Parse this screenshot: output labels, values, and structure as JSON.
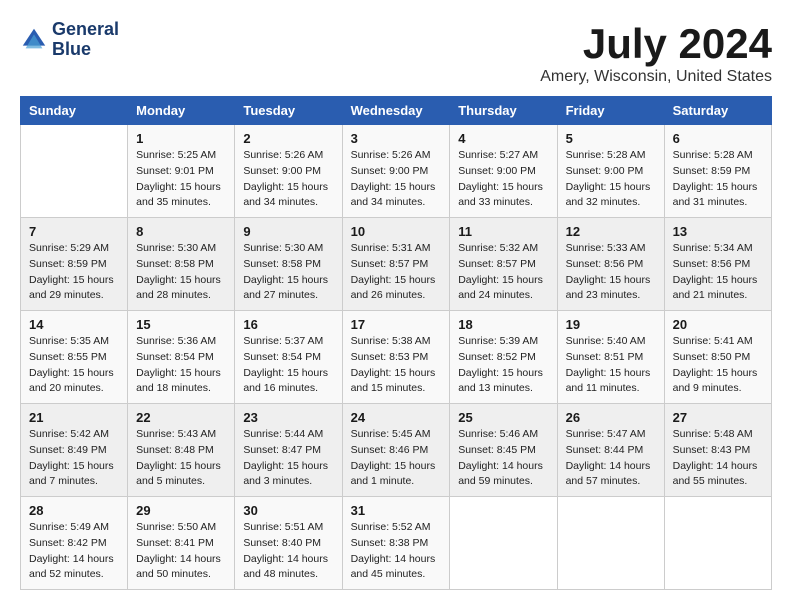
{
  "header": {
    "logo_line1": "General",
    "logo_line2": "Blue",
    "month": "July 2024",
    "location": "Amery, Wisconsin, United States"
  },
  "days_of_week": [
    "Sunday",
    "Monday",
    "Tuesday",
    "Wednesday",
    "Thursday",
    "Friday",
    "Saturday"
  ],
  "weeks": [
    [
      {
        "day": "",
        "info": ""
      },
      {
        "day": "1",
        "info": "Sunrise: 5:25 AM\nSunset: 9:01 PM\nDaylight: 15 hours\nand 35 minutes."
      },
      {
        "day": "2",
        "info": "Sunrise: 5:26 AM\nSunset: 9:00 PM\nDaylight: 15 hours\nand 34 minutes."
      },
      {
        "day": "3",
        "info": "Sunrise: 5:26 AM\nSunset: 9:00 PM\nDaylight: 15 hours\nand 34 minutes."
      },
      {
        "day": "4",
        "info": "Sunrise: 5:27 AM\nSunset: 9:00 PM\nDaylight: 15 hours\nand 33 minutes."
      },
      {
        "day": "5",
        "info": "Sunrise: 5:28 AM\nSunset: 9:00 PM\nDaylight: 15 hours\nand 32 minutes."
      },
      {
        "day": "6",
        "info": "Sunrise: 5:28 AM\nSunset: 8:59 PM\nDaylight: 15 hours\nand 31 minutes."
      }
    ],
    [
      {
        "day": "7",
        "info": "Sunrise: 5:29 AM\nSunset: 8:59 PM\nDaylight: 15 hours\nand 29 minutes."
      },
      {
        "day": "8",
        "info": "Sunrise: 5:30 AM\nSunset: 8:58 PM\nDaylight: 15 hours\nand 28 minutes."
      },
      {
        "day": "9",
        "info": "Sunrise: 5:30 AM\nSunset: 8:58 PM\nDaylight: 15 hours\nand 27 minutes."
      },
      {
        "day": "10",
        "info": "Sunrise: 5:31 AM\nSunset: 8:57 PM\nDaylight: 15 hours\nand 26 minutes."
      },
      {
        "day": "11",
        "info": "Sunrise: 5:32 AM\nSunset: 8:57 PM\nDaylight: 15 hours\nand 24 minutes."
      },
      {
        "day": "12",
        "info": "Sunrise: 5:33 AM\nSunset: 8:56 PM\nDaylight: 15 hours\nand 23 minutes."
      },
      {
        "day": "13",
        "info": "Sunrise: 5:34 AM\nSunset: 8:56 PM\nDaylight: 15 hours\nand 21 minutes."
      }
    ],
    [
      {
        "day": "14",
        "info": "Sunrise: 5:35 AM\nSunset: 8:55 PM\nDaylight: 15 hours\nand 20 minutes."
      },
      {
        "day": "15",
        "info": "Sunrise: 5:36 AM\nSunset: 8:54 PM\nDaylight: 15 hours\nand 18 minutes."
      },
      {
        "day": "16",
        "info": "Sunrise: 5:37 AM\nSunset: 8:54 PM\nDaylight: 15 hours\nand 16 minutes."
      },
      {
        "day": "17",
        "info": "Sunrise: 5:38 AM\nSunset: 8:53 PM\nDaylight: 15 hours\nand 15 minutes."
      },
      {
        "day": "18",
        "info": "Sunrise: 5:39 AM\nSunset: 8:52 PM\nDaylight: 15 hours\nand 13 minutes."
      },
      {
        "day": "19",
        "info": "Sunrise: 5:40 AM\nSunset: 8:51 PM\nDaylight: 15 hours\nand 11 minutes."
      },
      {
        "day": "20",
        "info": "Sunrise: 5:41 AM\nSunset: 8:50 PM\nDaylight: 15 hours\nand 9 minutes."
      }
    ],
    [
      {
        "day": "21",
        "info": "Sunrise: 5:42 AM\nSunset: 8:49 PM\nDaylight: 15 hours\nand 7 minutes."
      },
      {
        "day": "22",
        "info": "Sunrise: 5:43 AM\nSunset: 8:48 PM\nDaylight: 15 hours\nand 5 minutes."
      },
      {
        "day": "23",
        "info": "Sunrise: 5:44 AM\nSunset: 8:47 PM\nDaylight: 15 hours\nand 3 minutes."
      },
      {
        "day": "24",
        "info": "Sunrise: 5:45 AM\nSunset: 8:46 PM\nDaylight: 15 hours\nand 1 minute."
      },
      {
        "day": "25",
        "info": "Sunrise: 5:46 AM\nSunset: 8:45 PM\nDaylight: 14 hours\nand 59 minutes."
      },
      {
        "day": "26",
        "info": "Sunrise: 5:47 AM\nSunset: 8:44 PM\nDaylight: 14 hours\nand 57 minutes."
      },
      {
        "day": "27",
        "info": "Sunrise: 5:48 AM\nSunset: 8:43 PM\nDaylight: 14 hours\nand 55 minutes."
      }
    ],
    [
      {
        "day": "28",
        "info": "Sunrise: 5:49 AM\nSunset: 8:42 PM\nDaylight: 14 hours\nand 52 minutes."
      },
      {
        "day": "29",
        "info": "Sunrise: 5:50 AM\nSunset: 8:41 PM\nDaylight: 14 hours\nand 50 minutes."
      },
      {
        "day": "30",
        "info": "Sunrise: 5:51 AM\nSunset: 8:40 PM\nDaylight: 14 hours\nand 48 minutes."
      },
      {
        "day": "31",
        "info": "Sunrise: 5:52 AM\nSunset: 8:38 PM\nDaylight: 14 hours\nand 45 minutes."
      },
      {
        "day": "",
        "info": ""
      },
      {
        "day": "",
        "info": ""
      },
      {
        "day": "",
        "info": ""
      }
    ]
  ]
}
